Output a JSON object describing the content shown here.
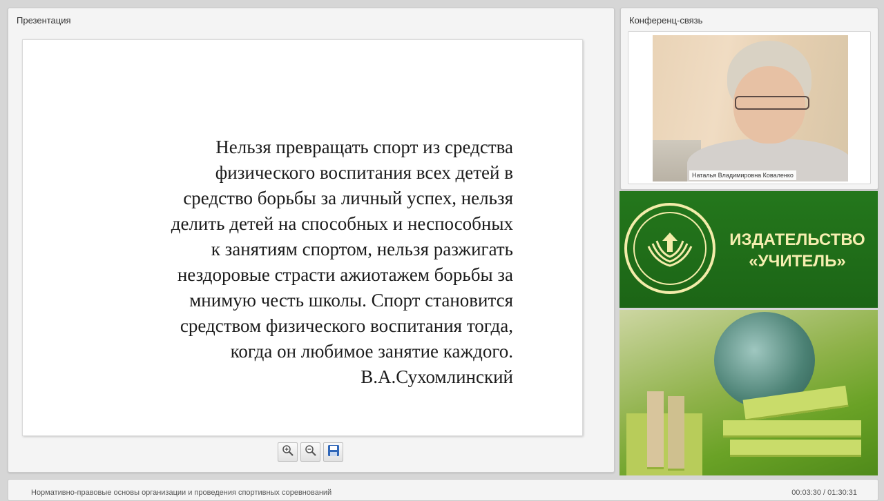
{
  "presentation": {
    "title": "Презентация",
    "quote_lines": "Нельзя превращать спорт из средства\nфизического воспитания всех детей в\nсредство борьбы за личный успех, нельзя\nделить детей на способных и неспособных\nк занятиям спортом, нельзя разжигать\nнездоровые страсти ажиотажем борьбы за\nмнимую честь школы. Спорт становится\nсредством физического воспитания тогда,\nкогда он любимое занятие каждого.",
    "quote_author": "В.А.Сухомлинский",
    "toolbar": {
      "zoom_in_icon": "zoom-in-icon",
      "zoom_out_icon": "zoom-out-icon",
      "save_icon": "save-icon"
    }
  },
  "conference": {
    "title": "Конференц-связь",
    "participant_name": "Наталья Владимировна Коваленко"
  },
  "publisher": {
    "name": "ИЗДАТЕЛЬСТВО\n«УЧИТЕЛЬ»",
    "colors": {
      "banner": "#1f6f18",
      "logo": "#f4ecaa"
    }
  },
  "footer": {
    "course_title": "Нормативно-правовые основы организации и проведения спортивных соревнований",
    "time": "00:03:30 / 01:30:31"
  }
}
